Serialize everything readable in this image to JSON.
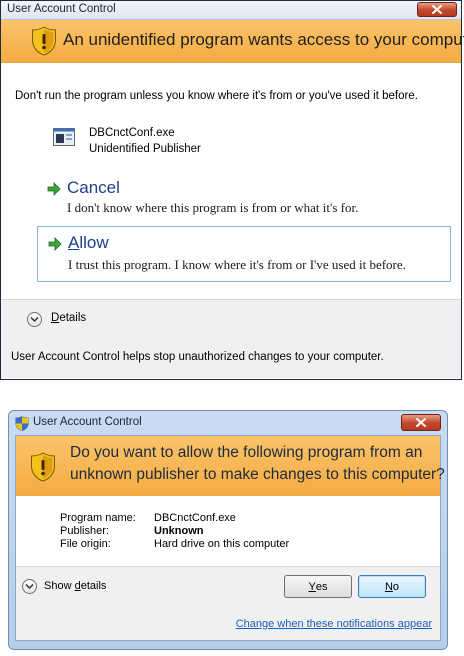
{
  "dialog1": {
    "title": "User Account Control",
    "heading": "An unidentified program wants access to your computer",
    "intro": "Don't run the program unless you know where it's from or you've used it before.",
    "program_name": "DBCnctConf.exe",
    "publisher": "Unidentified Publisher",
    "cancel": {
      "title": "Cancel",
      "subtitle": "I don't know where this program is from or what it's for."
    },
    "allow": {
      "title_first": "A",
      "title_rest": "llow",
      "subtitle": "I trust this program. I know where it's from or I've used it before."
    },
    "details_first": "D",
    "details_rest": "etails",
    "footer": "User Account Control helps stop unauthorized changes to your computer.",
    "icons": [
      "shield-warning-icon",
      "close-icon",
      "program-icon",
      "green-arrow-icon",
      "chevron-down-icon"
    ],
    "colors": {
      "banner": "#f5ab42",
      "command_link": "#1e3f8a",
      "close_button": "#c2472c"
    }
  },
  "dialog2": {
    "title": "User Account Control",
    "question_line1": "Do you want to allow the following program from an",
    "question_line2": "unknown publisher to make changes to this computer?",
    "info": {
      "program_name_label": "Program name:",
      "program_name_value": "DBCnctConf.exe",
      "publisher_label": "Publisher:",
      "publisher_value": "Unknown",
      "file_origin_label": "File origin:",
      "file_origin_value": "Hard drive on this computer"
    },
    "show_details_pre": "Show ",
    "show_details_u": "d",
    "show_details_post": "etails",
    "yes_u": "Y",
    "yes_rest": "es",
    "no_u": "N",
    "no_rest": "o",
    "change_link": "Change when these notifications appear",
    "icons": [
      "uac-shield-icon",
      "close-icon",
      "shield-warning-icon",
      "chevron-down-icon"
    ],
    "colors": {
      "frame": "#b5cde8",
      "link": "#1c5fb8"
    }
  }
}
